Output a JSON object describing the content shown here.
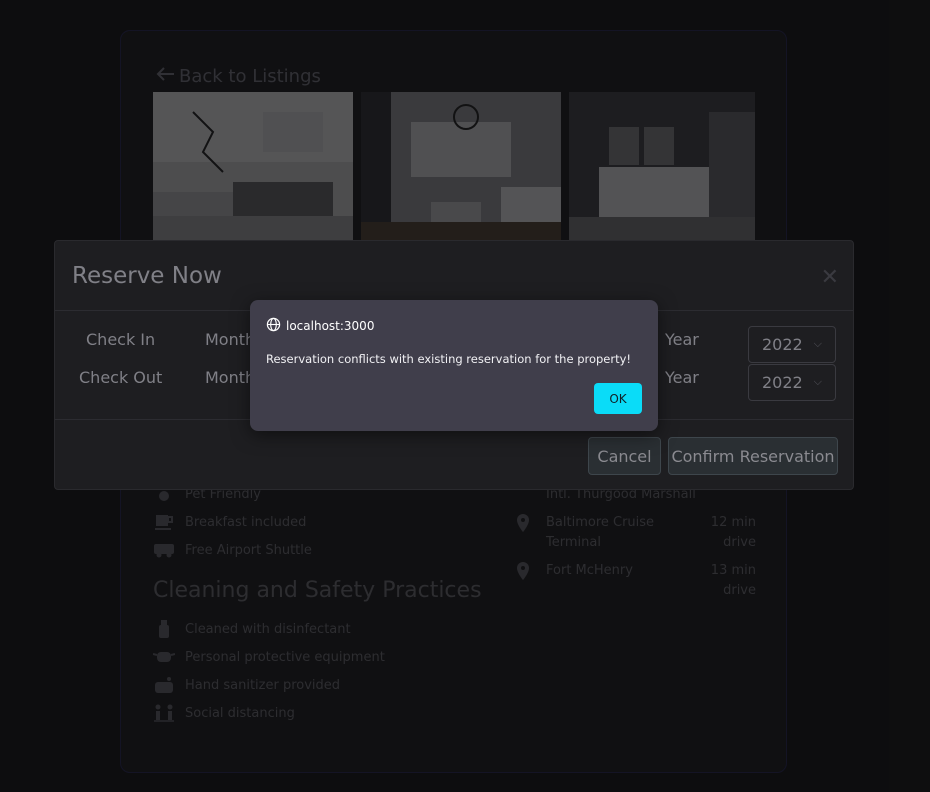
{
  "back_link": "Back to Listings",
  "amenities": [
    {
      "icon": "paw-icon",
      "label": "Pet Friendly"
    },
    {
      "icon": "coffee-cup-icon",
      "label": "Breakfast included"
    },
    {
      "icon": "shuttle-van-icon",
      "label": "Free Airport Shuttle"
    }
  ],
  "cleaning": {
    "title": "Cleaning and Safety Practices",
    "items": [
      {
        "icon": "disinfectant-spray-icon",
        "label": "Cleaned with disinfectant"
      },
      {
        "icon": "face-mask-icon",
        "label": "Personal protective equipment"
      },
      {
        "icon": "hand-sanitizer-icon",
        "label": "Hand sanitizer provided"
      },
      {
        "icon": "social-distancing-icon",
        "label": "Social distancing"
      }
    ]
  },
  "poi": [
    {
      "name": "Intl. Thurgood Marshall",
      "dist": ""
    },
    {
      "name": "Baltimore Cruise Terminal",
      "dist": "12 min drive"
    },
    {
      "name": "Fort McHenry",
      "dist": "13 min drive"
    }
  ],
  "modal": {
    "title": "Reserve Now",
    "check_in_label": "Check In",
    "check_out_label": "Check Out",
    "month_label": "Month",
    "year_label": "Year",
    "check_in_year": "2022",
    "check_out_year": "2022",
    "cancel_label": "Cancel",
    "confirm_label": "Confirm Reservation"
  },
  "alert": {
    "origin": "localhost:3000",
    "message": "Reservation conflicts with existing reservation for the property!",
    "ok_label": "OK"
  },
  "colors": {
    "alert_ok_bg": "#0adcf8",
    "alert_bg": "#403e4b",
    "page_bg": "#151517"
  }
}
